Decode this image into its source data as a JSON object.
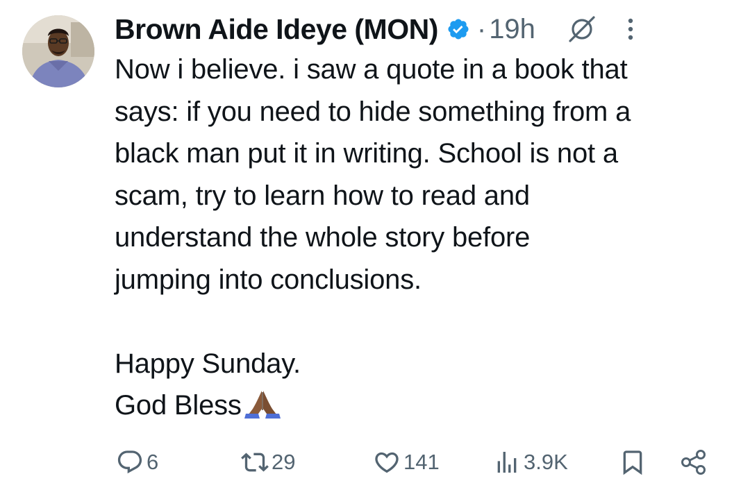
{
  "tweet": {
    "author": {
      "display_name": "Brown Aide Ideye (MON)",
      "verified_icon": "verified-badge-icon",
      "avatar_icon": "profile-avatar"
    },
    "separator": "·",
    "timestamp": "19h",
    "header_icons": [
      "grok-icon",
      "more-icon"
    ],
    "text_lines": [
      "Now i believe. i saw a quote in a book that",
      "says: if you need to hide something from a",
      "black man put it in writing. School is not a",
      "scam, try to learn how to read and",
      "understand the whole story before",
      "jumping into conclusions.",
      "",
      "Happy Sunday.",
      "God Bless"
    ],
    "closing_emoji": "folded-hands-emoji",
    "actions": {
      "replies": "6",
      "reposts": "29",
      "likes": "141",
      "views": "3.9K",
      "bookmark_icon": "bookmark-icon",
      "share_icon": "share-icon"
    }
  },
  "colors": {
    "text": "#0f1419",
    "secondary": "#536471",
    "verified": "#1d9bf0",
    "background": "#ffffff"
  }
}
